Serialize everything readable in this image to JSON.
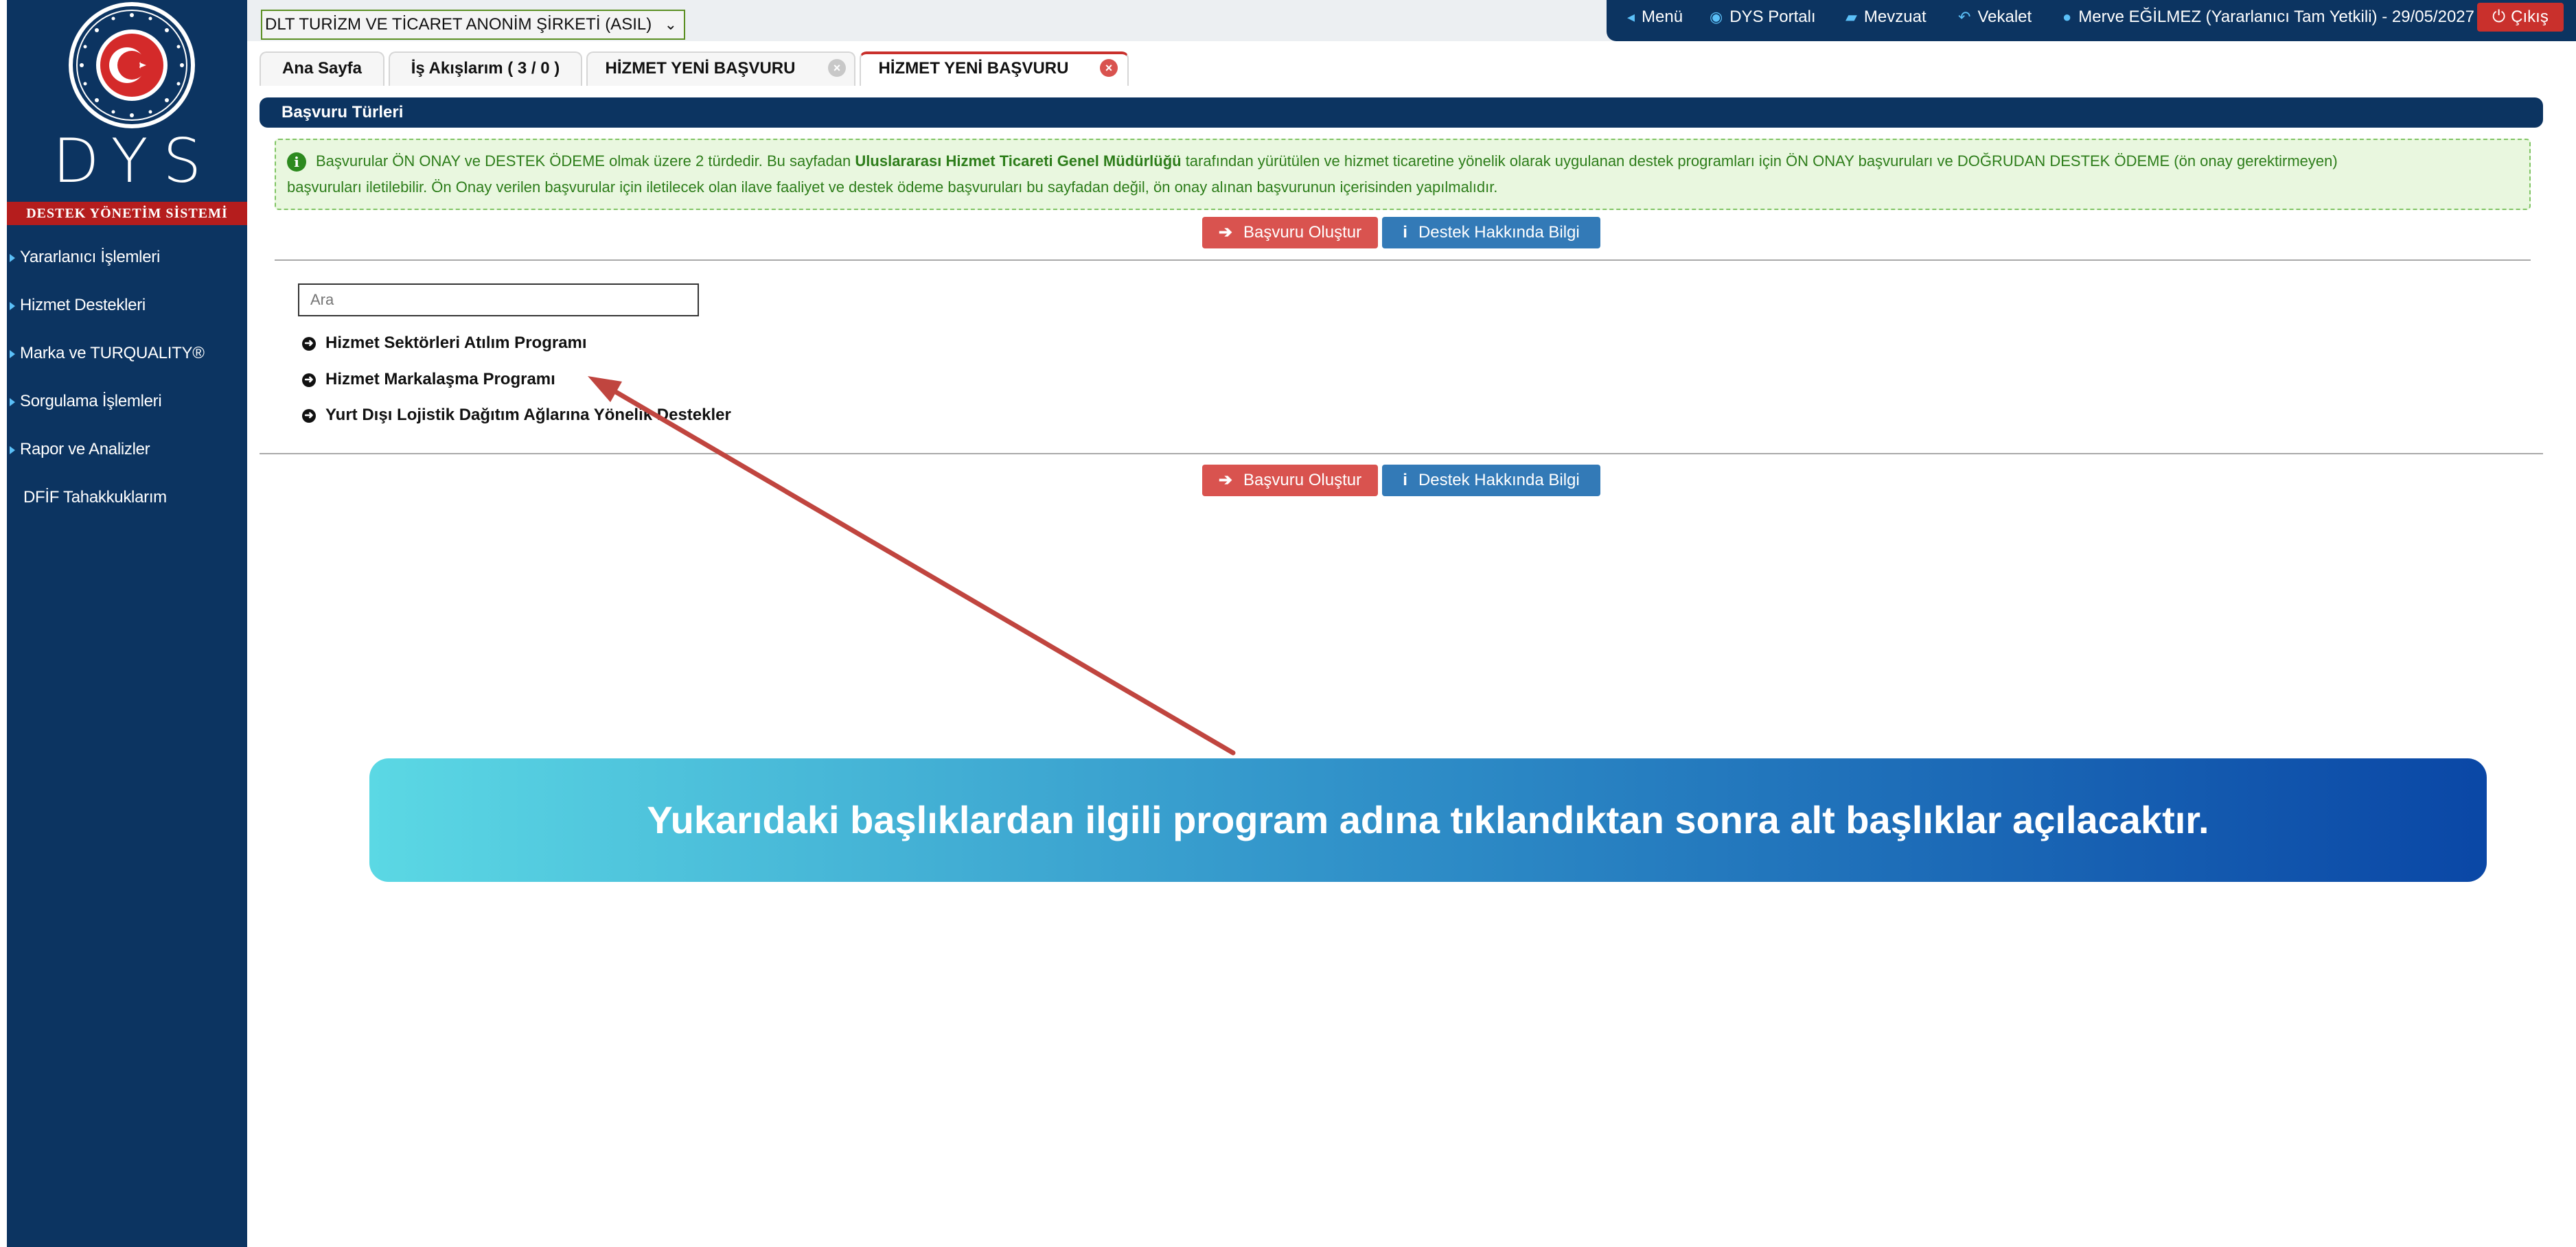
{
  "brand": {
    "logo_text": "DYS",
    "subtitle": "DESTEK YÖNETİM SİSTEMİ"
  },
  "sidebar": {
    "items": [
      {
        "label": "Yararlanıcı İşlemleri"
      },
      {
        "label": "Hizmet Destekleri"
      },
      {
        "label": "Marka ve TURQUALITY®"
      },
      {
        "label": "Sorgulama İşlemleri"
      },
      {
        "label": "Rapor ve Analizler"
      },
      {
        "label": "DFİF Tahakkuklarım"
      }
    ]
  },
  "header": {
    "company_select": "DLT TURİZM VE TİCARET ANONİM ŞİRKETİ (ASIL)",
    "menu": "Menü",
    "portal": "DYS Portalı",
    "legislation": "Mevzuat",
    "proxy": "Vekalet",
    "user": "Merve EĞİLMEZ (Yararlanıcı Tam Yetkili) - 29/05/2027",
    "logout": "Çıkış"
  },
  "tabs": [
    {
      "label": "Ana Sayfa"
    },
    {
      "label": "İş Akışlarım ( 3 / 0 )"
    },
    {
      "label": "HİZMET YENİ BAŞVURU"
    },
    {
      "label": "HİZMET YENİ BAŞVURU"
    }
  ],
  "panel": {
    "title": "Başvuru Türleri",
    "info_part1": "Başvurular ÖN ONAY ve DESTEK ÖDEME olmak üzere 2 türdedir. Bu sayfadan ",
    "info_bold": "Uluslararası Hizmet Ticareti Genel Müdürlüğü",
    "info_part2": " tarafından yürütülen ve hizmet ticaretine yönelik olarak uygulanan destek programları için ÖN ONAY başvuruları ve DOĞRUDAN DESTEK ÖDEME (ön onay gerektirmeyen)",
    "info_line2": "başvuruları iletilebilir. Ön Onay verilen başvurular için iletilecek olan ilave faaliyet ve destek ödeme başvuruları bu sayfadan değil, ön onay alınan başvurunun içerisinden yapılmalıdır.",
    "create_button": "Başvuru Oluştur",
    "info_button": "Destek Hakkında Bilgi",
    "search_placeholder": "Ara",
    "programs": [
      {
        "label": "Hizmet Sektörleri Atılım Programı"
      },
      {
        "label": "Hizmet Markalaşma Programı"
      },
      {
        "label": "Yurt Dışı Lojistik Dağıtım Ağlarına Yönelik Destekler"
      }
    ]
  },
  "callout": {
    "text": "Yukarıdaki başlıklardan ilgili program adına tıklandıktan sonra alt başlıklar açılacaktır."
  },
  "colors": {
    "navy": "#0c3461",
    "red": "#c9302c",
    "blue": "#337ab7",
    "green_text": "#2d7d1a",
    "arrow": "#c0453f"
  }
}
